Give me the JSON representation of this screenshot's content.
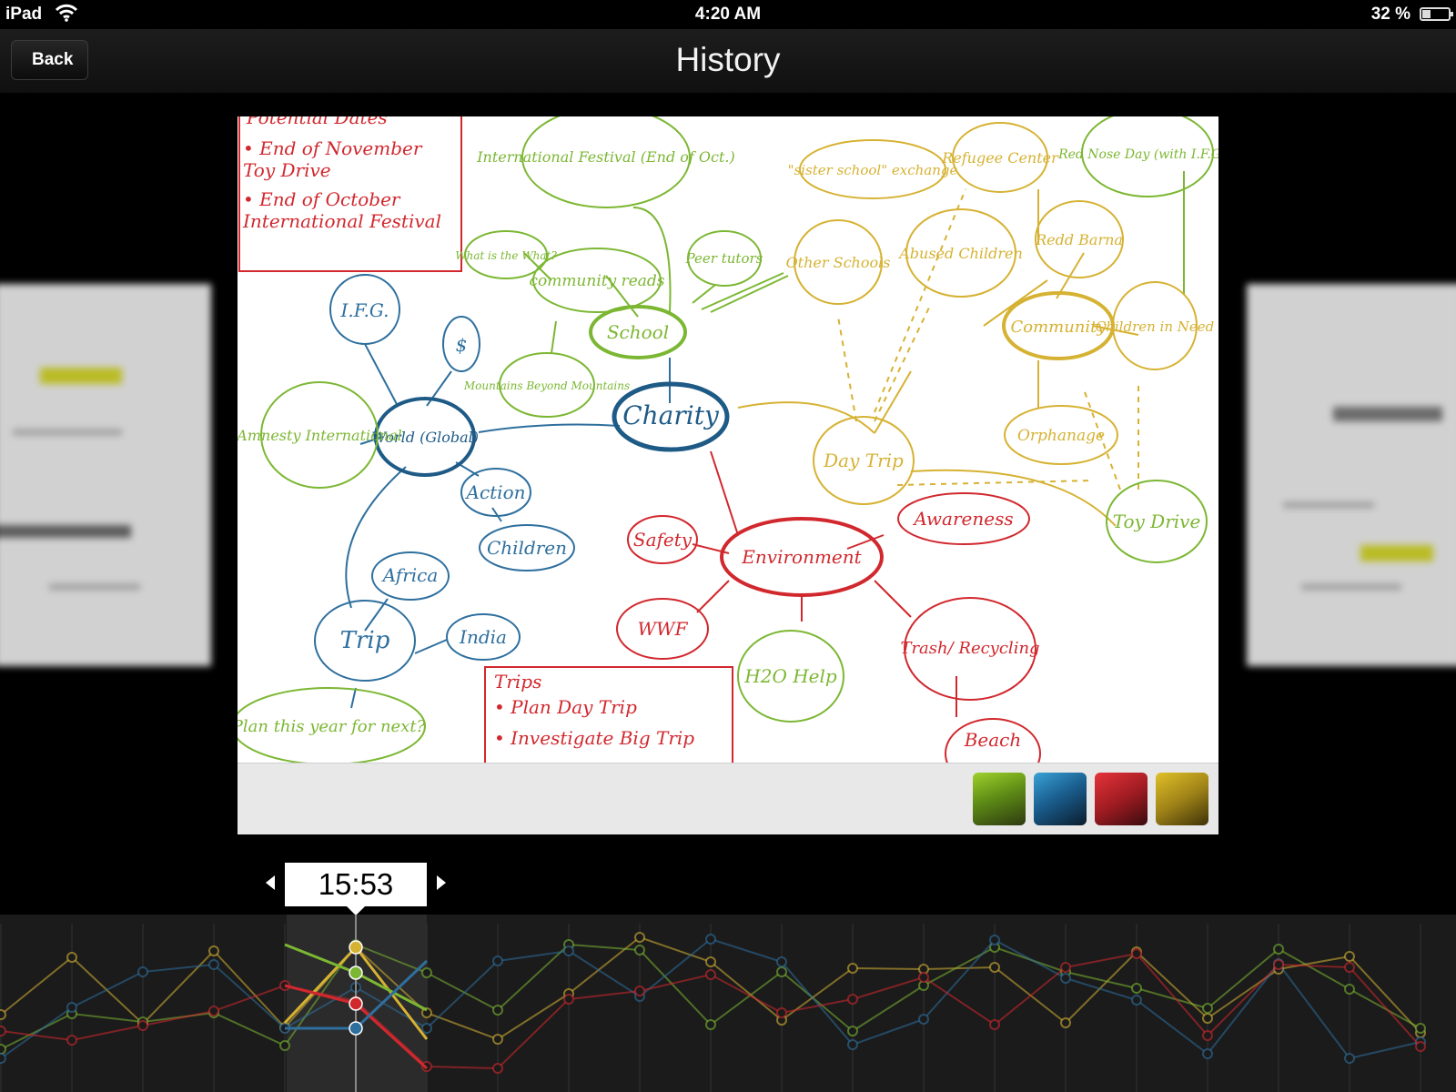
{
  "status_bar": {
    "carrier": "iPad",
    "time": "4:20 AM",
    "battery": "32 %"
  },
  "nav": {
    "back_label": "Back",
    "title": "History"
  },
  "timeline": {
    "current_time": "15:53"
  },
  "whiteboard": {
    "note_top_left": {
      "lines": [
        "Potential Dates",
        "• End of November",
        "  Toy Drive",
        "• End of October",
        "  International Festival"
      ]
    },
    "note_trips": {
      "lines": [
        "Trips",
        "• Plan Day Trip",
        "• Investigate Big Trip"
      ]
    },
    "nodes": {
      "charity": "Charity",
      "school": "School",
      "world": "World (Global)",
      "environment": "Environment",
      "community": "Community",
      "ifg": "I.F.G.",
      "dollar": "$",
      "amnesty": "Amnesty International",
      "action": "Action",
      "children": "Children",
      "trip": "Trip",
      "africa": "Africa",
      "india": "India",
      "plan_this_year": "Plan this year for next?",
      "international_festival": "International Festival (End of Oct.)",
      "what_is": "What is the What?",
      "community_reads": "community reads",
      "peer_tutors": "Peer tutors",
      "mountains": "Mountains Beyond Mountains",
      "sister_school": "\"sister school\" exchange",
      "refugee": "Refugee Center",
      "red_nose": "Red Nose Day (with I.F.G.?)",
      "other_schools": "Other Schools",
      "abused_children": "Abused Children",
      "redd_barna": "Redd Barna",
      "children_in_need": "Children in Need",
      "day_trip": "Day Trip",
      "orphanage": "Orphanage",
      "toy_drive": "Toy Drive",
      "safety": "Safety",
      "awareness": "Awareness",
      "wwf": "WWF",
      "h2o_help": "H2O Help",
      "trash_recycling": "Trash/ Recycling",
      "beach": "Beach"
    }
  },
  "colors": {
    "green": "#7cb733",
    "blue": "#2e6f9e",
    "red": "#d1282e",
    "yellow": "#d6b233"
  }
}
